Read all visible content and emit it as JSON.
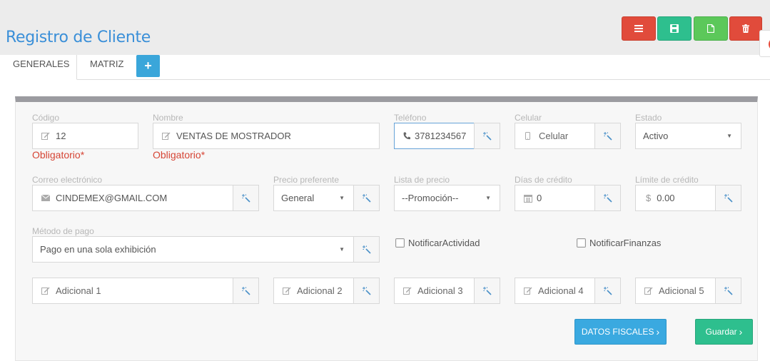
{
  "header": {
    "title": "Registro de Cliente"
  },
  "toolbar": [
    {
      "name": "list-button",
      "icon": "list-icon",
      "color": "#e14b3b"
    },
    {
      "name": "save-button",
      "icon": "floppy-icon",
      "color": "#2ebf8e"
    },
    {
      "name": "new-button",
      "icon": "file-icon",
      "color": "#5cc85a"
    },
    {
      "name": "delete-button",
      "icon": "trash-icon",
      "color": "#e14b3b"
    }
  ],
  "tabs": {
    "generales": "GENERALES",
    "matriz": "MATRIZ",
    "add": "+"
  },
  "form": {
    "codigo": {
      "label": "Código",
      "value": "12",
      "required": "Obligatorio*"
    },
    "nombre": {
      "label": "Nombre",
      "value": "VENTAS DE MOSTRADOR",
      "required": "Obligatorio*"
    },
    "telefono": {
      "label": "Teléfono",
      "value": "3781234567"
    },
    "celular": {
      "label": "Celular",
      "placeholder": "Celular"
    },
    "estado": {
      "label": "Estado",
      "value": "Activo"
    },
    "correo": {
      "label": "Correo electrónico",
      "value": "CINDEMEX@GMAIL.COM"
    },
    "precio_preferente": {
      "label": "Precio preferente",
      "value": "General"
    },
    "lista_precio": {
      "label": "Lista de precio",
      "value": "--Promoción--"
    },
    "dias_credito": {
      "label": "Días de crédito",
      "value": "0"
    },
    "limite_credito": {
      "label": "Límite de crédito",
      "value": "0.00",
      "prefix": "$"
    },
    "metodo_pago": {
      "label": "Método de pago",
      "value": "Pago en una sola exhibición"
    },
    "notificar_actividad": "NotificarActividad",
    "notificar_finanzas": "NotificarFinanzas",
    "adicional": [
      "Adicional 1",
      "Adicional 2",
      "Adicional 3",
      "Adicional 4",
      "Adicional 5"
    ]
  },
  "buttons": {
    "datos_fiscales": "DATOS FISCALES",
    "guardar": "Guardar",
    "chevron": "›"
  },
  "colors": {
    "accent": "#3a8fd8",
    "required": "#d64535",
    "panel_bar": "#9b9ba0"
  }
}
